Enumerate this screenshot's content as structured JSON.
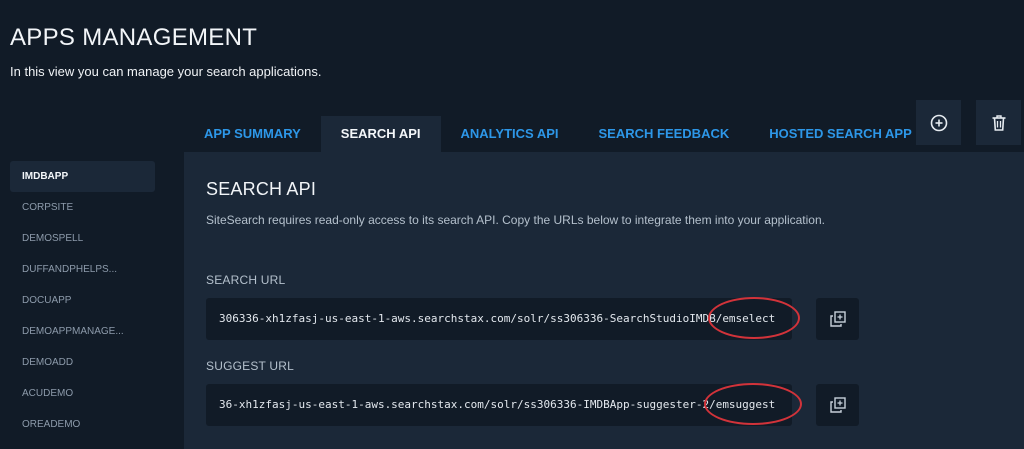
{
  "header": {
    "title": "APPS MANAGEMENT",
    "subtitle": "In this view you can manage your search applications."
  },
  "sidebar": {
    "items": [
      {
        "label": "IMDBAPP",
        "active": true
      },
      {
        "label": "CORPSITE",
        "active": false
      },
      {
        "label": "DEMOSPELL",
        "active": false
      },
      {
        "label": "DUFFANDPHELPS...",
        "active": false
      },
      {
        "label": "DOCUAPP",
        "active": false
      },
      {
        "label": "DEMOAPPMANAGE...",
        "active": false
      },
      {
        "label": "DEMOADD",
        "active": false
      },
      {
        "label": "ACUDEMO",
        "active": false
      },
      {
        "label": "OREADEMO",
        "active": false
      }
    ]
  },
  "tabs": [
    {
      "label": "APP SUMMARY",
      "active": false
    },
    {
      "label": "SEARCH API",
      "active": true
    },
    {
      "label": "ANALYTICS API",
      "active": false
    },
    {
      "label": "SEARCH FEEDBACK",
      "active": false
    },
    {
      "label": "HOSTED SEARCH APP",
      "active": false
    }
  ],
  "toolbar": {
    "add_icon": "plus-circle-icon",
    "delete_icon": "trash-icon"
  },
  "panel": {
    "title": "SEARCH API",
    "description": "SiteSearch requires read-only access to its search API. Copy the URLs below to integrate them into your application.",
    "search_url": {
      "label": "SEARCH URL",
      "value": "306336-xh1zfasj-us-east-1-aws.searchstax.com/solr/ss306336-SearchStudioIMDB/emselect",
      "copy_icon": "copy-icon"
    },
    "suggest_url": {
      "label": "SUGGEST URL",
      "value": "36-xh1zfasj-us-east-1-aws.searchstax.com/solr/ss306336-IMDBApp-suggester-2/emsuggest",
      "copy_icon": "copy-icon"
    }
  },
  "colors": {
    "background": "#111b27",
    "panel": "#1b2838",
    "accent": "#2d97e8",
    "annotation": "#d2333a"
  }
}
